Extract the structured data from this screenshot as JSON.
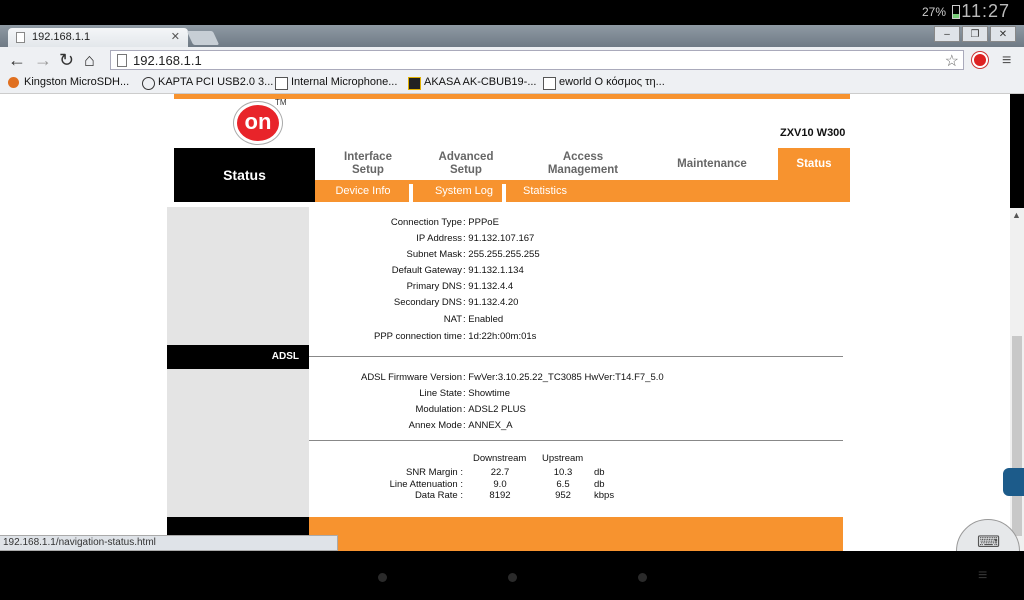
{
  "statusbar": {
    "battery": "27%",
    "clock": "11:27"
  },
  "browser": {
    "tab_title": "192.168.1.1",
    "url": "192.168.1.1",
    "bookmarks": [
      "Kingston MicroSDH...",
      "KAPTA PCI USB2.0 3...",
      "Internal Microphone...",
      "AKASA AK-CBUB19-...",
      "eworld Ο κόσμος τη..."
    ],
    "status_url": "192.168.1.1/navigation-status.html"
  },
  "router": {
    "logo": "on",
    "model": "ZXV10 W300",
    "page_title": "Status",
    "nav": [
      "Interface Setup",
      "Advanced Setup",
      "Access Management",
      "Maintenance",
      "Status"
    ],
    "subnav": [
      "Device Info",
      "System Log",
      "Statistics"
    ],
    "adsl_section": "ADSL",
    "wan": [
      {
        "label": "Connection Type",
        "value": "PPPoE"
      },
      {
        "label": "IP Address",
        "value": "91.132.107.167"
      },
      {
        "label": "Subnet Mask",
        "value": "255.255.255.255"
      },
      {
        "label": "Default Gateway",
        "value": "91.132.1.134"
      },
      {
        "label": "Primary DNS",
        "value": "91.132.4.4"
      },
      {
        "label": "Secondary DNS",
        "value": "91.132.4.20"
      },
      {
        "label": "NAT",
        "value": "Enabled"
      },
      {
        "label": "PPP connection time",
        "value": "1d:22h:00m:01s"
      }
    ],
    "adsl": [
      {
        "label": "ADSL Firmware Version",
        "value": "FwVer:3.10.25.22_TC3085 HwVer:T14.F7_5.0"
      },
      {
        "label": "Line State",
        "value": "Showtime"
      },
      {
        "label": "Modulation",
        "value": "ADSL2 PLUS"
      },
      {
        "label": "Annex Mode",
        "value": "ANNEX_A"
      }
    ],
    "stats": {
      "headers": [
        "Downstream",
        "Upstream"
      ],
      "rows": [
        {
          "label": "SNR Margin :",
          "down": "22.7",
          "up": "10.3",
          "unit": "db"
        },
        {
          "label": "Line Attenuation :",
          "down": "9.0",
          "up": "6.5",
          "unit": "db"
        },
        {
          "label": "Data Rate :",
          "down": "8192",
          "up": "952",
          "unit": "kbps"
        }
      ]
    }
  }
}
